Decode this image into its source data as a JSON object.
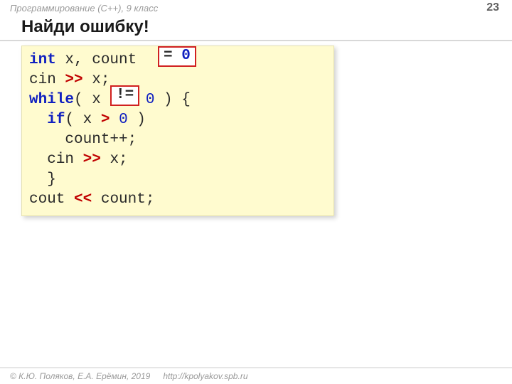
{
  "header": {
    "course": "Программирование (C++), 9 класс",
    "page": "23"
  },
  "title": "Найди ошибку!",
  "code": {
    "l1_kw": "int",
    "l1_rest": " x, count   ;",
    "l2_a": "cin ",
    "l2_op": ">>",
    "l2_b": " x;",
    "l3_kw": "while",
    "l3_a": "( x     ",
    "l3_zero": "0",
    "l3_b": " ) {",
    "l4_pad": "  ",
    "l4_kw": "if",
    "l4_a": "( x ",
    "l4_op": ">",
    "l4_sp": " ",
    "l4_zero": "0",
    "l4_b": " )",
    "l5": "    count++;",
    "l6_a": "  cin ",
    "l6_op": ">>",
    "l6_b": " x;",
    "l7": "  }",
    "l8_a": "cout ",
    "l8_op": "<<",
    "l8_b": " count;"
  },
  "fixes": {
    "init_eq": "= ",
    "init_zero": "0",
    "neq": "!="
  },
  "footer": {
    "copyright": "© К.Ю. Поляков, Е.А. Ерёмин, 2019",
    "url": "http://kpolyakov.spb.ru"
  }
}
